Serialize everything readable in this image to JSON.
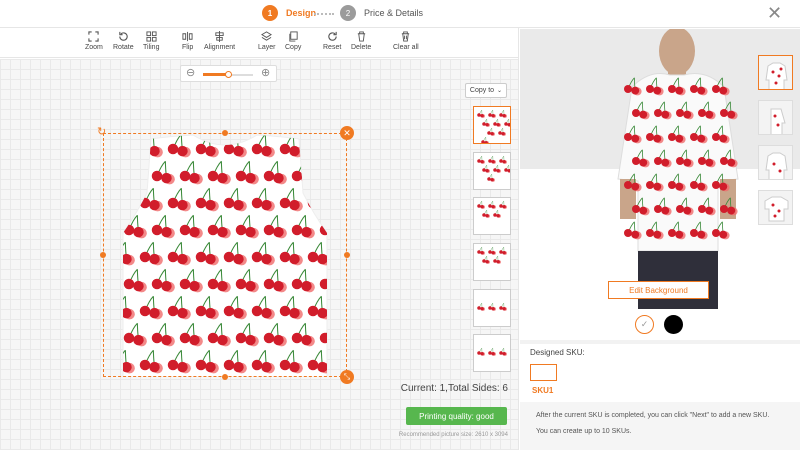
{
  "steps": [
    {
      "num": "1",
      "label": "Design"
    },
    {
      "num": "2",
      "label": "Price & Details"
    }
  ],
  "close_icon": "close-icon",
  "toolbar": [
    {
      "label": "Zoom",
      "icon": "zoom-icon"
    },
    {
      "label": "Rotate",
      "icon": "rotate-icon"
    },
    {
      "label": "Tiling",
      "icon": "tiling-icon"
    },
    {
      "label": "Flip",
      "icon": "flip-icon"
    },
    {
      "label": "Alignment",
      "icon": "alignment-icon"
    },
    {
      "label": "Layer",
      "icon": "layer-icon"
    },
    {
      "label": "Copy",
      "icon": "copy-icon"
    },
    {
      "label": "Reset",
      "icon": "reset-icon"
    },
    {
      "label": "Delete",
      "icon": "delete-icon"
    },
    {
      "label": "Clear all",
      "icon": "clear-all-icon"
    }
  ],
  "zoom": {
    "level": 0.5
  },
  "copy_to": "Copy to",
  "status": {
    "current_sides": "Current: 1,Total Sides: 6",
    "quality": "Printing quality: good",
    "recommended": "Recommended picture size: 2610 x 3094"
  },
  "preview": {
    "edit_background": "Edit Background",
    "colors": [
      "#ffffff",
      "#000000"
    ]
  },
  "sku": {
    "designed_label": "Designed SKU:",
    "name": "SKU1",
    "note1": "After the current SKU is completed, you can click \"Next\" to add a new SKU.",
    "note2": "You can create up to 10 SKUs."
  },
  "colors": {
    "accent": "#f07a22",
    "quality": "#57b74e",
    "cherry": "#d11d2b"
  }
}
